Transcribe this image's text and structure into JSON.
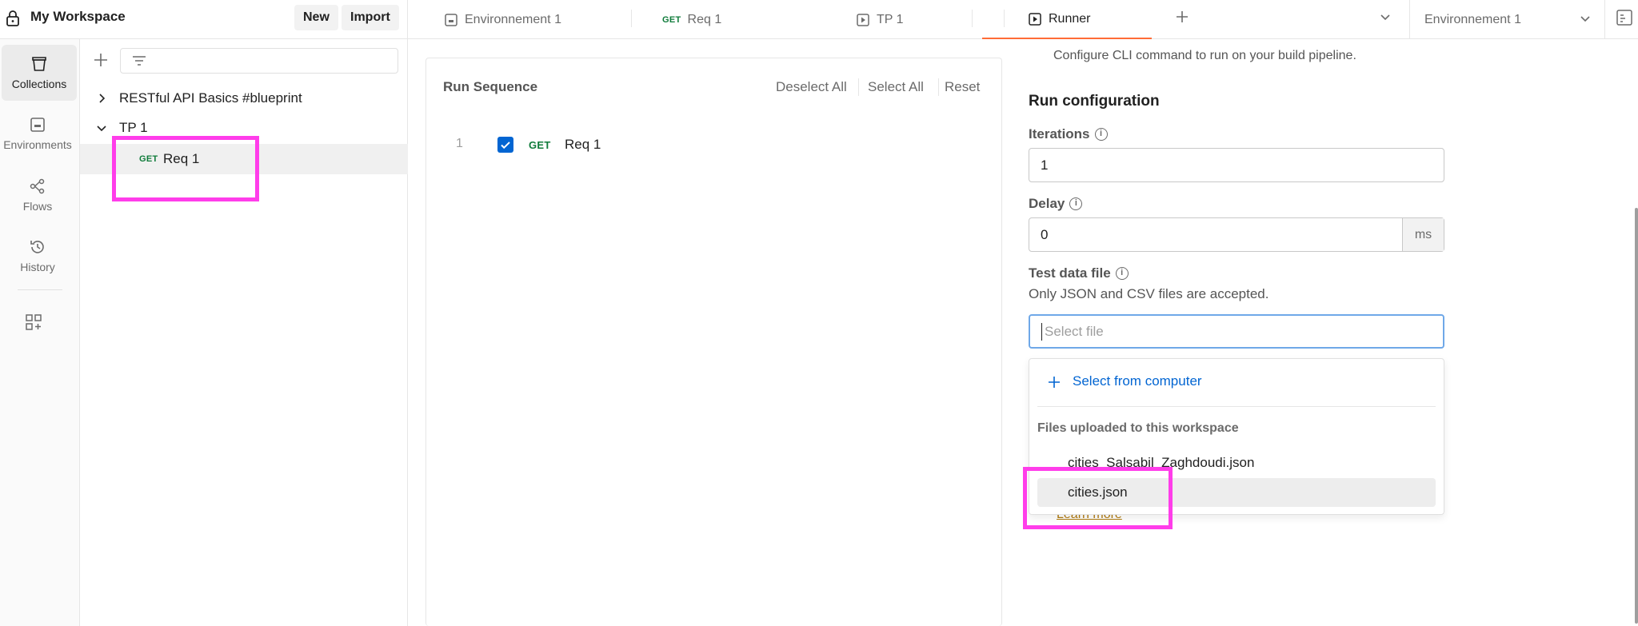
{
  "workspace": {
    "name": "My Workspace",
    "new_label": "New",
    "import_label": "Import"
  },
  "tabs": [
    {
      "label": "Environnement 1"
    },
    {
      "method": "GET",
      "label": "Req 1"
    },
    {
      "label": "TP 1"
    },
    {
      "label": "Runner"
    }
  ],
  "environment_selector": {
    "label": "Environnement 1"
  },
  "left_nav": [
    {
      "label": "Collections",
      "icon": "collections-icon"
    },
    {
      "label": "Environments",
      "icon": "environments-icon"
    },
    {
      "label": "Flows",
      "icon": "flows-icon"
    },
    {
      "label": "History",
      "icon": "history-icon"
    }
  ],
  "sidebar": {
    "collections": [
      {
        "name": "RESTful API Basics #blueprint",
        "expanded": false
      },
      {
        "name": "TP 1",
        "expanded": true,
        "requests": [
          {
            "method": "GET",
            "name": "Req 1"
          }
        ]
      }
    ]
  },
  "run_sequence": {
    "title": "Run Sequence",
    "deselect_all": "Deselect All",
    "select_all": "Select All",
    "reset": "Reset",
    "items": [
      {
        "index": "1",
        "checked": true,
        "method": "GET",
        "name": "Req 1"
      }
    ]
  },
  "run_config": {
    "cli_text": "Configure CLI command to run on your build pipeline.",
    "title": "Run configuration",
    "iterations_label": "Iterations",
    "iterations_value": "1",
    "delay_label": "Delay",
    "delay_value": "0",
    "delay_unit": "ms",
    "test_data_label": "Test data file",
    "test_data_hint": "Only JSON and CSV files are accepted.",
    "file_placeholder": "Select file",
    "select_from_computer": "Select from computer",
    "uploaded_heading": "Files uploaded to this workspace",
    "files": [
      "cities_Salsabil_Zaghdoudi.json",
      "cities.json"
    ],
    "learn_more": "Learn more"
  },
  "colors": {
    "accent": "#ff6c37",
    "highlight": "#ff3dea",
    "link": "#0265d2",
    "get_method": "#0f7b3a",
    "focus": "#6fa8e8"
  }
}
